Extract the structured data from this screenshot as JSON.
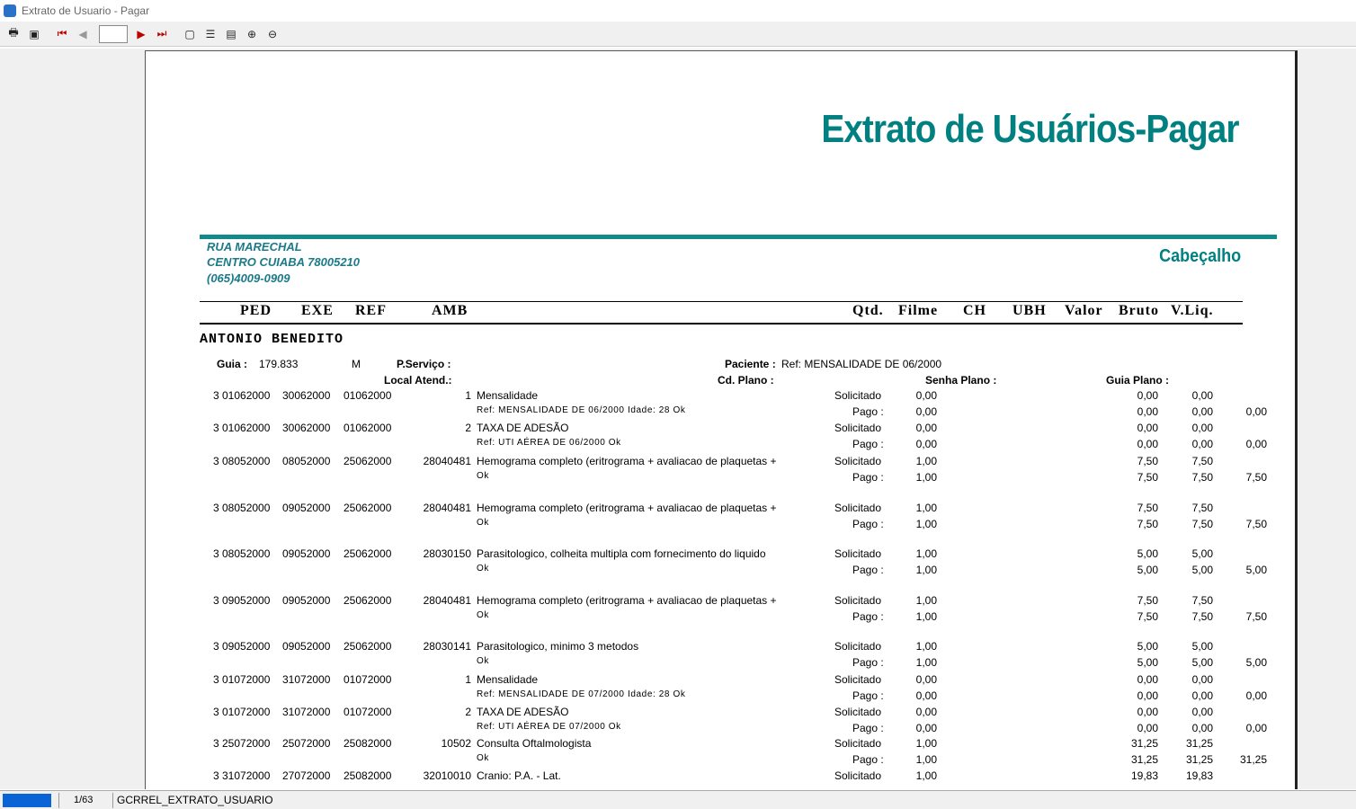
{
  "window": {
    "title": "Extrato de Usuario - Pagar"
  },
  "toolbar": {
    "page_value": ""
  },
  "report": {
    "title": "Extrato de Usuários-Pagar",
    "address": [
      "RUA MARECHAL",
      "CENTRO CUIABA 78005210",
      "(065)4009-0909"
    ],
    "section": "Cabeçalho",
    "columns": [
      "PED",
      "EXE",
      "REF",
      "AMB",
      "Qtd.",
      "Filme",
      "CH",
      "UBH",
      "Valor",
      "Bruto",
      "V.Liq."
    ],
    "patient": "ANTONIO BENEDITO",
    "guia_label": "Guia :",
    "guia_value": "179.833",
    "guia_type": "M",
    "pservico_label": "P.Serviço :",
    "paciente_label": "Paciente :",
    "paciente_value": "Ref: MENSALIDADE DE 06/2000",
    "local_label": "Local Atend.:",
    "cdplano_label": "Cd. Plano :",
    "senha_label": "Senha Plano :",
    "guiaplano_label": "Guia Plano :",
    "rows": [
      {
        "ped": "3 01062000",
        "exe": "30062000",
        "ref": "01062000",
        "amb": "1",
        "desc": "Mensalidade",
        "sub": "Ref: MENSALIDADE DE 06/2000 Idade: 28  Ok",
        "qs": "0,00",
        "qp": "0,00",
        "v1s": "0,00",
        "v2s": "0,00",
        "v1p": "0,00",
        "v2p": "0,00",
        "v3p": "0,00"
      },
      {
        "ped": "3 01062000",
        "exe": "30062000",
        "ref": "01062000",
        "amb": "2",
        "desc": "TAXA DE ADESÃO",
        "sub": "Ref: UTI AÉREA DE 06/2000  Ok",
        "qs": "0,00",
        "qp": "0,00",
        "v1s": "0,00",
        "v2s": "0,00",
        "v1p": "0,00",
        "v2p": "0,00",
        "v3p": "0,00"
      },
      {
        "ped": "3 08052000",
        "exe": "08052000",
        "ref": "25062000",
        "amb": "28040481",
        "desc": "Hemograma completo (eritrograma + avaliacao de plaquetas +",
        "sub": "Ok",
        "qs": "1,00",
        "qp": "1,00",
        "v1s": "7,50",
        "v2s": "7,50",
        "v1p": "7,50",
        "v2p": "7,50",
        "v3p": "7,50"
      },
      {
        "ped": "3 08052000",
        "exe": "09052000",
        "ref": "25062000",
        "amb": "28040481",
        "desc": "Hemograma completo (eritrograma + avaliacao de plaquetas +",
        "sub": "Ok",
        "qs": "1,00",
        "qp": "1,00",
        "v1s": "7,50",
        "v2s": "7,50",
        "v1p": "7,50",
        "v2p": "7,50",
        "v3p": "7,50"
      },
      {
        "ped": "3 08052000",
        "exe": "09052000",
        "ref": "25062000",
        "amb": "28030150",
        "desc": "Parasitologico, colheita multipla com fornecimento do liquido",
        "sub": "Ok",
        "qs": "1,00",
        "qp": "1,00",
        "v1s": "5,00",
        "v2s": "5,00",
        "v1p": "5,00",
        "v2p": "5,00",
        "v3p": "5,00"
      },
      {
        "ped": "3 09052000",
        "exe": "09052000",
        "ref": "25062000",
        "amb": "28040481",
        "desc": "Hemograma completo (eritrograma + avaliacao de plaquetas +",
        "sub": "Ok",
        "qs": "1,00",
        "qp": "1,00",
        "v1s": "7,50",
        "v2s": "7,50",
        "v1p": "7,50",
        "v2p": "7,50",
        "v3p": "7,50"
      },
      {
        "ped": "3 09052000",
        "exe": "09052000",
        "ref": "25062000",
        "amb": "28030141",
        "desc": "Parasitologico, minimo 3 metodos",
        "sub": "Ok",
        "qs": "1,00",
        "qp": "1,00",
        "v1s": "5,00",
        "v2s": "5,00",
        "v1p": "5,00",
        "v2p": "5,00",
        "v3p": "5,00"
      },
      {
        "ped": "3 01072000",
        "exe": "31072000",
        "ref": "01072000",
        "amb": "1",
        "desc": "Mensalidade",
        "sub": "Ref: MENSALIDADE DE 07/2000 Idade: 28  Ok",
        "qs": "0,00",
        "qp": "0,00",
        "v1s": "0,00",
        "v2s": "0,00",
        "v1p": "0,00",
        "v2p": "0,00",
        "v3p": "0,00"
      },
      {
        "ped": "3 01072000",
        "exe": "31072000",
        "ref": "01072000",
        "amb": "2",
        "desc": "TAXA DE ADESÃO",
        "sub": "Ref: UTI AÉREA DE 07/2000  Ok",
        "qs": "0,00",
        "qp": "0,00",
        "v1s": "0,00",
        "v2s": "0,00",
        "v1p": "0,00",
        "v2p": "0,00",
        "v3p": "0,00"
      },
      {
        "ped": "3 25072000",
        "exe": "25072000",
        "ref": "25082000",
        "amb": "10502",
        "desc": "Consulta Oftalmologista",
        "sub": "Ok",
        "qs": "1,00",
        "qp": "1,00",
        "v1s": "31,25",
        "v2s": "31,25",
        "v1p": "31,25",
        "v2p": "31,25",
        "v3p": "31,25"
      },
      {
        "ped": "3 31072000",
        "exe": "27072000",
        "ref": "25082000",
        "amb": "32010010",
        "desc": "Cranio: P.A. - Lat.",
        "sub": "",
        "qs": "1,00",
        "qp": "",
        "v1s": "19,83",
        "v2s": "19,83",
        "v1p": "",
        "v2p": "",
        "v3p": ""
      }
    ],
    "solicitado": "Solicitado",
    "pago": "Pago :"
  },
  "status": {
    "page": "1/63",
    "report_name": "GCRREL_EXTRATO_USUARIO"
  }
}
